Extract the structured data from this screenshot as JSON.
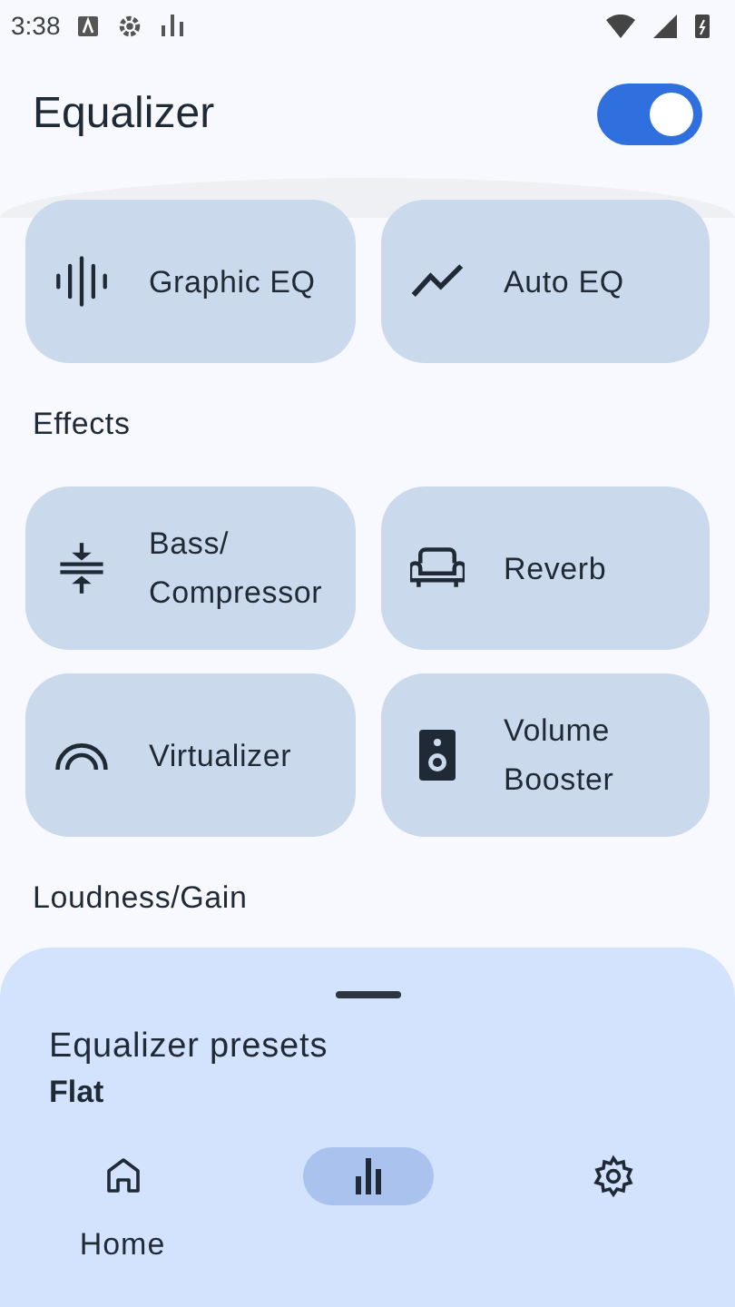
{
  "status_bar": {
    "time": "3:38"
  },
  "header": {
    "title": "Equalizer",
    "switch_on": true
  },
  "top_tiles": [
    {
      "label": "Graphic EQ",
      "kind": "waveform"
    },
    {
      "label": "Auto EQ",
      "kind": "trend"
    }
  ],
  "sections": [
    {
      "title": "Effects",
      "tiles": [
        {
          "label": "Bass/\nCompressor",
          "kind": "compress"
        },
        {
          "label": "Reverb",
          "kind": "sofa"
        },
        {
          "label": "Virtualizer",
          "kind": "arc"
        },
        {
          "label": "Volume\nBooster",
          "kind": "speaker"
        }
      ]
    },
    {
      "title": "Loudness/Gain"
    }
  ],
  "bottom_sheet": {
    "title": "Equalizer presets",
    "value": "Flat"
  },
  "nav": [
    {
      "kind": "home",
      "label": "Home",
      "selected": false
    },
    {
      "kind": "bars",
      "selected": true
    },
    {
      "kind": "gear",
      "selected": false
    }
  ]
}
